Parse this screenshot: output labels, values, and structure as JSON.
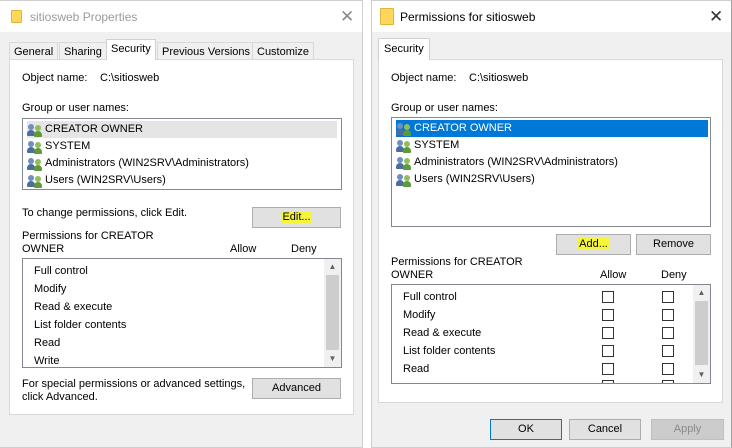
{
  "left": {
    "title": "sitiosweb Properties",
    "tabs": [
      "General",
      "Sharing",
      "Security",
      "Previous Versions",
      "Customize"
    ],
    "active_tab": "Security",
    "object_name_label": "Object name:",
    "object_name_value": "C:\\sitiosweb",
    "groups_label": "Group or user names:",
    "groups": [
      "CREATOR OWNER",
      "SYSTEM",
      "Administrators (WIN2SRV\\Administrators)",
      "Users (WIN2SRV\\Users)"
    ],
    "change_text": "To change permissions, click Edit.",
    "edit_button": "Edit...",
    "perm_label_1": "Permissions for CREATOR",
    "perm_label_2": "OWNER",
    "allow": "Allow",
    "deny": "Deny",
    "permissions": [
      "Full control",
      "Modify",
      "Read & execute",
      "List folder contents",
      "Read",
      "Write"
    ],
    "special_1": "For special permissions or advanced settings,",
    "special_2": "click Advanced.",
    "advanced_button": "Advanced"
  },
  "right": {
    "title": "Permissions for sitiosweb",
    "tab": "Security",
    "object_name_label": "Object name:",
    "object_name_value": "C:\\sitiosweb",
    "groups_label": "Group or user names:",
    "groups": [
      "CREATOR OWNER",
      "SYSTEM",
      "Administrators (WIN2SRV\\Administrators)",
      "Users (WIN2SRV\\Users)"
    ],
    "add_button": "Add...",
    "remove_button": "Remove",
    "perm_label_1": "Permissions for CREATOR",
    "perm_label_2": "OWNER",
    "allow": "Allow",
    "deny": "Deny",
    "permissions": [
      "Full control",
      "Modify",
      "Read & execute",
      "List folder contents",
      "Read"
    ],
    "ok_button": "OK",
    "cancel_button": "Cancel",
    "apply_button": "Apply"
  },
  "icons": {
    "window": "folder-icon",
    "principal": "users-icon",
    "close": "close-icon"
  },
  "colors": {
    "selection": "#0078d7",
    "highlight": "#f5f53a",
    "default_button_border": "#0078d7"
  }
}
